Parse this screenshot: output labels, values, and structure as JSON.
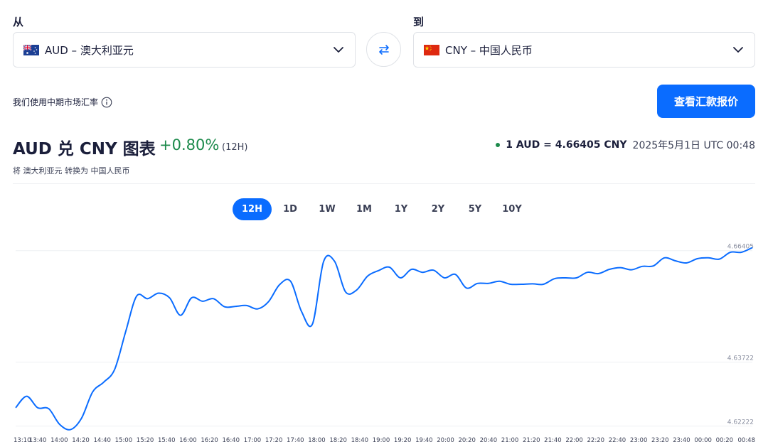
{
  "from": {
    "label": "从",
    "currency": "AUD – 澳大利亚元",
    "flag": "australia-flag"
  },
  "to": {
    "label": "到",
    "currency": "CNY – 中国人民币",
    "flag": "china-flag"
  },
  "swap_icon": "swap-arrows-icon",
  "mid_market_note": "我们使用中期市场汇率",
  "cta_label": "查看汇款报价",
  "chart_header": {
    "title": "AUD 兑 CNY 图表",
    "change": "+0.80%",
    "period": "(12H)",
    "subtitle": "将 澳大利亚元 转换为 中国人民币",
    "rate": "1 AUD = 4.66405 CNY",
    "timestamp": "2025年5月1日 UTC 00:48"
  },
  "period_tabs": [
    "12H",
    "1D",
    "1W",
    "1M",
    "1Y",
    "2Y",
    "5Y",
    "10Y"
  ],
  "active_period": "12H",
  "colors": {
    "accent": "#0a6cff",
    "positive": "#1c8a4b",
    "line": "#0a6cff",
    "text": "#1b1f3b"
  },
  "chart_data": {
    "type": "line",
    "title": "",
    "xlabel": "",
    "ylabel": "",
    "y_tick_labels": [
      "4.66405",
      "4.63722",
      "4.62222"
    ],
    "ylim": [
      4.6208,
      4.6665
    ],
    "x": [
      "13:10",
      "13:20",
      "13:30",
      "13:40",
      "13:50",
      "14:00",
      "14:10",
      "14:20",
      "14:30",
      "14:40",
      "14:50",
      "15:00",
      "15:10",
      "15:20",
      "15:30",
      "15:40",
      "15:50",
      "16:00",
      "16:10",
      "16:20",
      "16:30",
      "16:40",
      "16:50",
      "17:00",
      "17:10",
      "17:20",
      "17:30",
      "17:40",
      "17:50",
      "18:00",
      "18:10",
      "18:20",
      "18:30",
      "18:40",
      "18:50",
      "19:00",
      "19:10",
      "19:20",
      "19:30",
      "19:40",
      "19:50",
      "20:00",
      "20:10",
      "20:20",
      "20:30",
      "20:40",
      "20:50",
      "21:00",
      "21:10",
      "21:20",
      "21:30",
      "21:40",
      "21:50",
      "22:00",
      "22:10",
      "22:20",
      "22:30",
      "22:40",
      "22:50",
      "23:00",
      "23:10",
      "23:20",
      "23:30",
      "23:40",
      "23:50",
      "00:00",
      "00:10",
      "00:20",
      "00:30",
      "00:40",
      "00:48"
    ],
    "x_tick_labels": [
      "13:10",
      "13:40",
      "14:00",
      "14:20",
      "14:40",
      "15:00",
      "15:20",
      "15:40",
      "16:00",
      "16:20",
      "16:40",
      "17:00",
      "17:20",
      "17:40",
      "18:00",
      "18:20",
      "18:40",
      "19:00",
      "19:20",
      "19:40",
      "20:00",
      "20:20",
      "20:40",
      "21:00",
      "21:20",
      "21:40",
      "22:00",
      "22:20",
      "22:40",
      "23:00",
      "23:20",
      "23:40",
      "00:00",
      "00:20",
      "00:48"
    ],
    "series": [
      {
        "values": [
          4.6265,
          4.6292,
          4.6265,
          4.6263,
          4.6226,
          4.6214,
          4.6241,
          4.6302,
          4.6325,
          4.6355,
          4.6443,
          4.6527,
          4.6521,
          4.6534,
          4.6523,
          4.6482,
          4.6523,
          4.6515,
          4.6521,
          4.6502,
          4.6503,
          4.6505,
          4.6497,
          4.6514,
          4.6554,
          4.6562,
          4.6491,
          4.6462,
          4.6608,
          4.6609,
          4.6537,
          4.6541,
          4.6574,
          4.6587,
          4.6595,
          4.657,
          4.659,
          4.6583,
          4.6588,
          4.657,
          4.6578,
          4.6546,
          4.6557,
          4.6557,
          4.6562,
          4.6555,
          4.6555,
          4.6556,
          4.6555,
          4.6568,
          4.657,
          4.657,
          4.6583,
          4.658,
          4.659,
          4.6594,
          4.6589,
          4.6597,
          4.6598,
          4.6617,
          4.661,
          4.6605,
          4.6615,
          4.6617,
          4.6614,
          4.663,
          4.663,
          4.6641
        ]
      }
    ],
    "grid": true,
    "legend": "none"
  }
}
